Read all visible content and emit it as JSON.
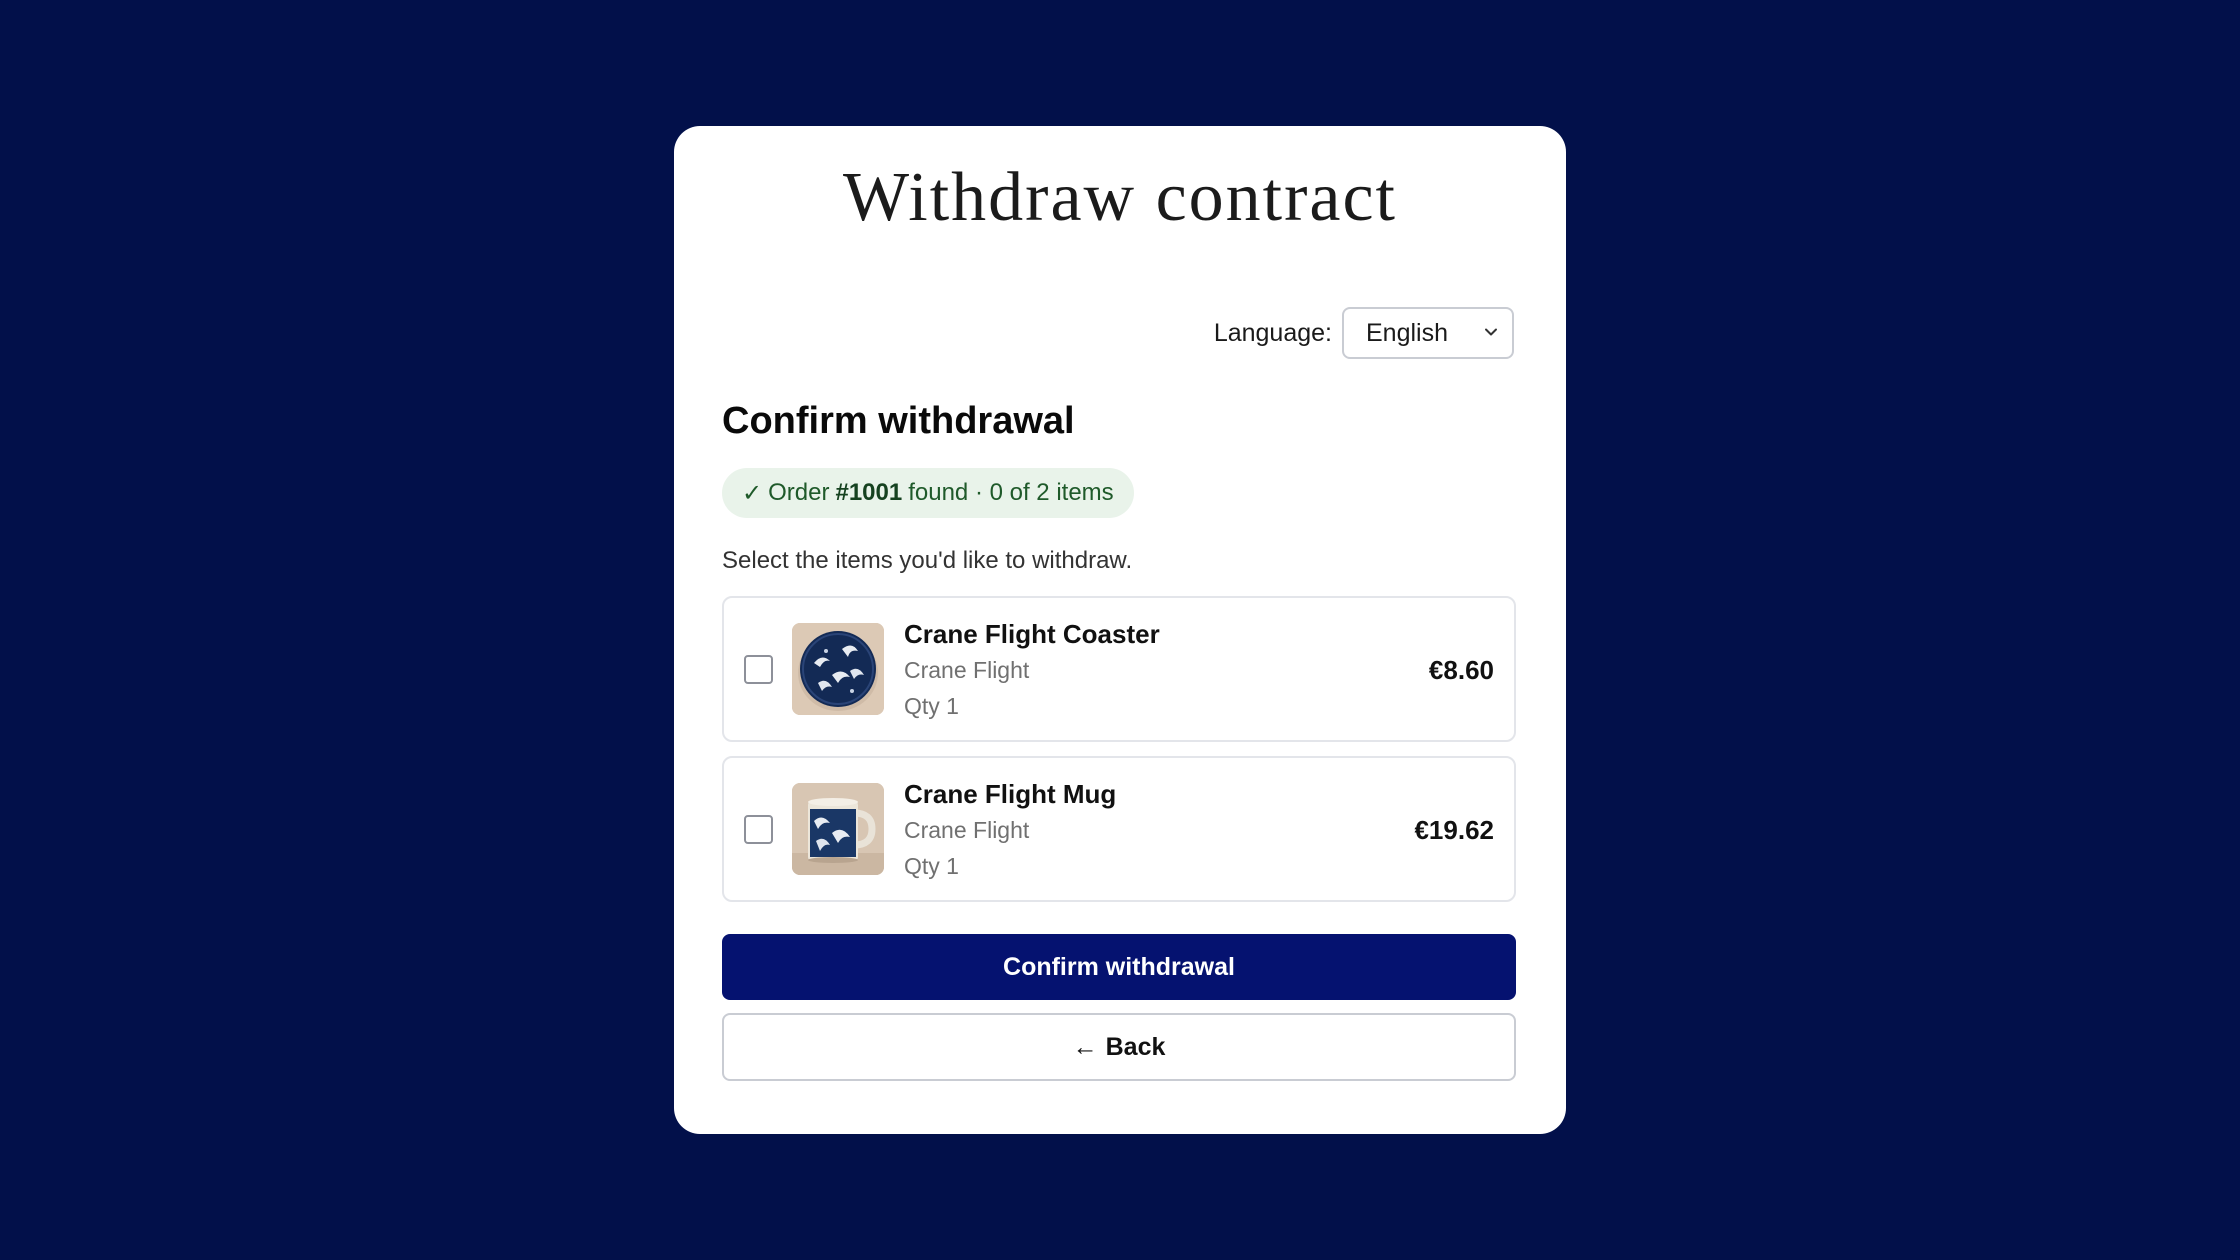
{
  "page": {
    "title": "Withdraw contract"
  },
  "language": {
    "label": "Language:",
    "selected": "English"
  },
  "section": {
    "title": "Confirm withdrawal"
  },
  "badge": {
    "check": "✓",
    "prefix": "Order",
    "order_number": "#1001",
    "suffix": "found · 0 of 2 items"
  },
  "instructions": "Select the items you'd like to withdraw.",
  "items": [
    {
      "name": "Crane Flight Coaster",
      "variant": "Crane Flight",
      "qty": "Qty 1",
      "price": "€8.60",
      "checked": false
    },
    {
      "name": "Crane Flight Mug",
      "variant": "Crane Flight",
      "qty": "Qty 1",
      "price": "€19.62",
      "checked": false
    }
  ],
  "actions": {
    "confirm_label": "Confirm withdrawal",
    "back_arrow": "←",
    "back_label": "Back"
  },
  "colors": {
    "background": "#02104a",
    "primary": "#051270",
    "badge_bg": "#e9f3ea",
    "badge_text": "#1f5a2a"
  }
}
